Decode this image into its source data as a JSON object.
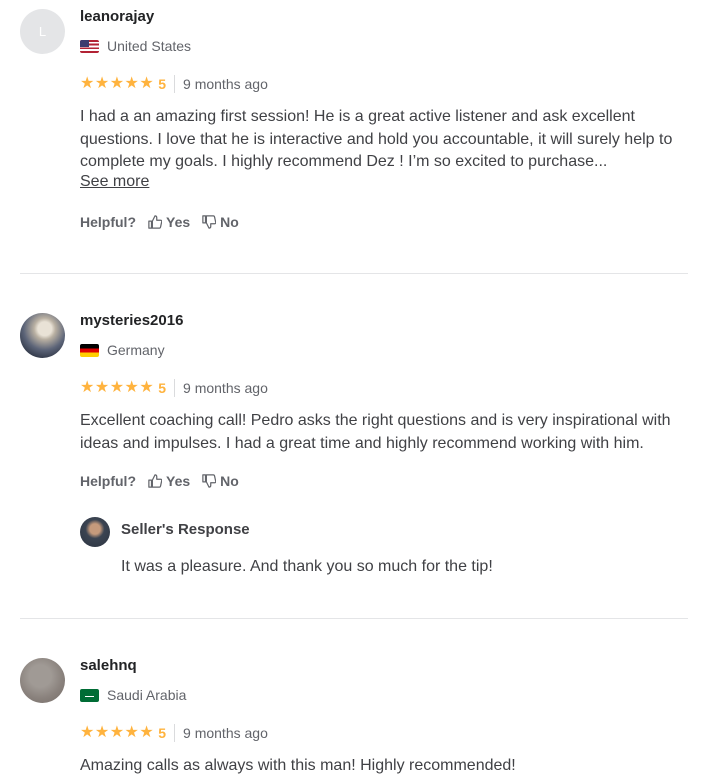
{
  "reviews": [
    {
      "avatar_letter": "L",
      "username": "leanorajay",
      "country": "United States",
      "stars": "★★★★★",
      "rating": "5",
      "time": "9 months ago",
      "text": "I had a an amazing first session! He is a great active listener and ask excellent questions. I love that he is interactive and hold you accountable, it will surely help to complete my goals. I highly recommend Dez ! I’m so excited to purchase...",
      "see_more": "See more",
      "helpful_label": "Helpful?",
      "yes_label": "Yes",
      "no_label": "No"
    },
    {
      "username": "mysteries2016",
      "country": "Germany",
      "stars": "★★★★★",
      "rating": "5",
      "time": "9 months ago",
      "text": "Excellent coaching call! Pedro asks the right questions and is very inspirational with ideas and impulses. I had a great time and highly recommend working with him.",
      "helpful_label": "Helpful?",
      "yes_label": "Yes",
      "no_label": "No",
      "seller_response": {
        "title": "Seller's Response",
        "text": "It was a pleasure. And thank you so much for the tip!"
      }
    },
    {
      "username": "salehnq",
      "country": "Saudi Arabia",
      "stars": "★★★★★",
      "rating": "5",
      "time": "9 months ago",
      "text": "Amazing calls as always with this man! Highly recommended!"
    }
  ]
}
